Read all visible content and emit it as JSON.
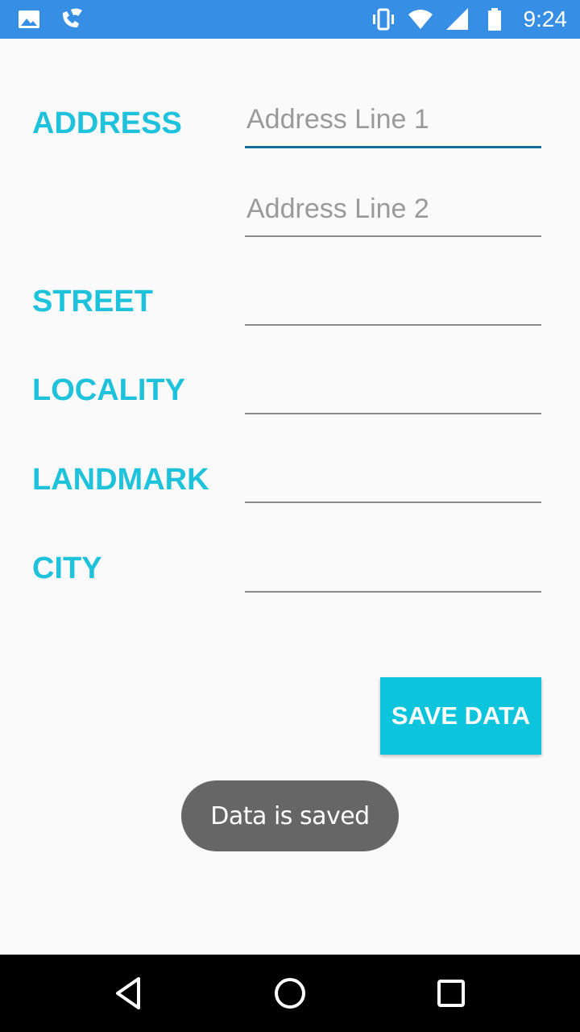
{
  "status_bar": {
    "time": "9:24",
    "left_icons": [
      "image-icon",
      "phone-wifi-icon"
    ],
    "right_icons": [
      "vibrate-icon",
      "wifi-icon",
      "signal-icon",
      "battery-icon"
    ],
    "background_color": "#378fe5"
  },
  "form": {
    "accent_color": "#1ec2da",
    "address": {
      "label": "ADDRESS",
      "line1_placeholder": "Address Line 1",
      "line2_placeholder": "Address Line 2",
      "line1_value": "",
      "line2_value": ""
    },
    "street": {
      "label": "STREET",
      "value": ""
    },
    "locality": {
      "label": "LOCALITY",
      "value": ""
    },
    "landmark": {
      "label": "LANDMARK",
      "value": ""
    },
    "city": {
      "label": "CITY",
      "value": ""
    }
  },
  "save_button": {
    "label": "SAVE DATA",
    "color": "#0cc5dd"
  },
  "toast": {
    "message": "Data is saved"
  },
  "nav_bar": {
    "icons": [
      "back-icon",
      "home-icon",
      "recents-icon"
    ]
  }
}
